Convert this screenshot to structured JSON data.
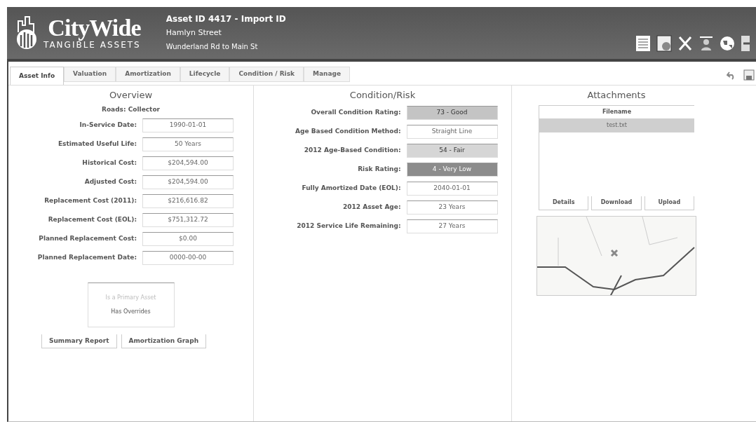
{
  "header": {
    "logo_title": "CityWide",
    "logo_subtitle": "TANGIBLE ASSETS",
    "asset_title": "Asset ID 4417 - Import ID",
    "street": "Hamlyn Street",
    "segment": "Wunderland Rd to Main St"
  },
  "tabs": [
    {
      "label": "Asset Info",
      "selected": true
    },
    {
      "label": "Valuation",
      "selected": false
    },
    {
      "label": "Amortization",
      "selected": false
    },
    {
      "label": "Lifecycle",
      "selected": false
    },
    {
      "label": "Condition / Risk",
      "selected": false
    },
    {
      "label": "Manage",
      "selected": false
    }
  ],
  "overview": {
    "title": "Overview",
    "category": "Roads: Collector",
    "fields": [
      {
        "label": "In-Service Date:",
        "value": "1990-01-01"
      },
      {
        "label": "Estimated Useful Life:",
        "value": "50 Years"
      },
      {
        "label": "Historical Cost:",
        "value": "$204,594.00"
      },
      {
        "label": "Adjusted Cost:",
        "value": "$204,594.00"
      },
      {
        "label": "Replacement Cost (2011):",
        "value": "$216,616.82"
      },
      {
        "label": "Replacement Cost (EOL):",
        "value": "$751,312.72"
      },
      {
        "label": "Planned Replacement Cost:",
        "value": "$0.00"
      },
      {
        "label": "Planned Replacement Date:",
        "value": "0000-00-00"
      }
    ],
    "flags": [
      {
        "label": "Is a Primary Asset",
        "on": false
      },
      {
        "label": "Has Overrides",
        "on": true
      }
    ],
    "buttons": [
      "Summary Report",
      "Amortization Graph"
    ]
  },
  "condition": {
    "title": "Condition/Risk",
    "fields": [
      {
        "label": "Overall Condition Rating:",
        "value": "73 - Good",
        "color": "#c4c4c4"
      },
      {
        "label": "Age Based Condition Method:",
        "value": "Straight Line"
      },
      {
        "label": "2012 Age-Based Condition:",
        "value": "54 - Fair",
        "color": "#d6d6d6"
      },
      {
        "label": "Risk Rating:",
        "value": "4 - Very Low",
        "color": "#8c8c8c"
      },
      {
        "label": "Fully Amortized Date (EOL):",
        "value": "2040-01-01"
      },
      {
        "label": "2012 Asset Age:",
        "value": "23 Years"
      },
      {
        "label": "2012 Service Life Remaining:",
        "value": "27 Years"
      }
    ]
  },
  "attachments": {
    "title": "Attachments",
    "column": "Filename",
    "files": [
      {
        "name": "test.txt",
        "selected": true
      }
    ],
    "buttons": [
      "Details",
      "Download",
      "Upload"
    ]
  }
}
